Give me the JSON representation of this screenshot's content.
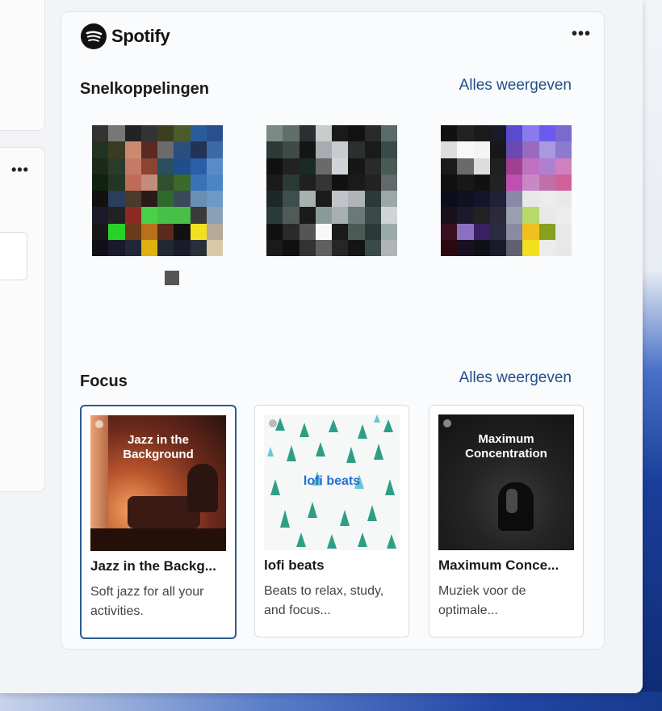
{
  "app": {
    "name": "Spotify",
    "more": "•••"
  },
  "left": {
    "more": "•••"
  },
  "shortcuts": {
    "title": "Snelkoppelingen",
    "see_all": "Alles weergeven",
    "items": [
      {
        "name": "shortcut-1"
      },
      {
        "name": "shortcut-2"
      },
      {
        "name": "shortcut-3"
      }
    ]
  },
  "focus": {
    "title": "Focus",
    "see_all": "Alles weergeven",
    "items": [
      {
        "cover_text": "Jazz in the Background",
        "title": "Jazz in the Backg...",
        "description": "Soft jazz for all your activities."
      },
      {
        "cover_text": "lofi beats",
        "title": "lofi beats",
        "description": "Beats to relax, study, and focus..."
      },
      {
        "cover_text": "Maximum Concentration",
        "title": "Maximum Conce...",
        "description": "Muziek voor de optimale..."
      }
    ]
  },
  "colors": {
    "link": "#1e4f88",
    "selected_border": "#2c5a93"
  }
}
